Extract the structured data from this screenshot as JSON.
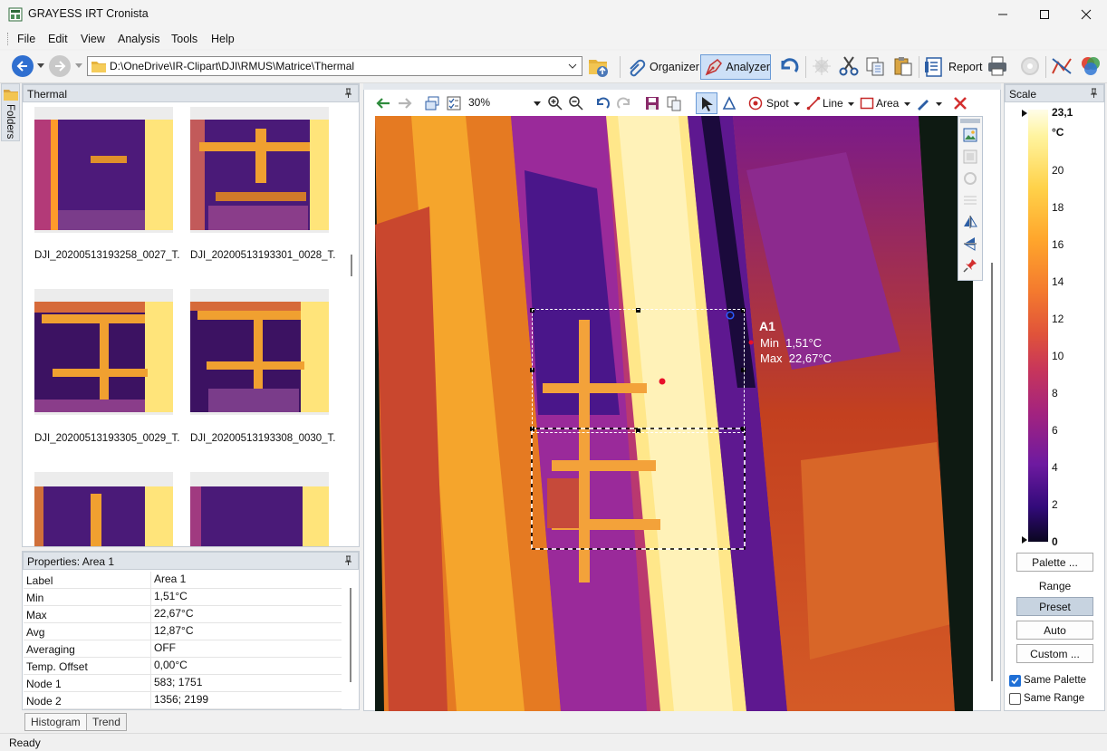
{
  "window": {
    "title": "GRAYESS IRT Cronista"
  },
  "menu": [
    "File",
    "Edit",
    "View",
    "Analysis",
    "Tools",
    "Help"
  ],
  "toolbar": {
    "path": "D:\\OneDrive\\IR-Clipart\\DJI\\RMUS\\Matrice\\Thermal",
    "organizer_label": "Organizer",
    "analyzer_label": "Analyzer",
    "report_label": "Report"
  },
  "thermal_panel": {
    "title": "Thermal",
    "items": [
      {
        "label": "DJI_20200513193258_0027_T..."
      },
      {
        "label": "DJI_20200513193301_0028_T..."
      },
      {
        "label": "DJI_20200513193305_0029_T..."
      },
      {
        "label": "DJI_20200513193308_0030_T..."
      }
    ]
  },
  "folders_tab": {
    "label": "Folders"
  },
  "properties": {
    "title": "Properties: Area 1",
    "rows": [
      {
        "key": "Label",
        "value": "Area 1"
      },
      {
        "key": "Min",
        "value": "1,51°C"
      },
      {
        "key": "Max",
        "value": "22,67°C"
      },
      {
        "key": "Avg",
        "value": "12,87°C"
      },
      {
        "key": "Averaging",
        "value": "OFF"
      },
      {
        "key": "Temp. Offset",
        "value": "0,00°C"
      },
      {
        "key": "Node 1",
        "value": "583; 1751"
      },
      {
        "key": "Node 2",
        "value": "1356; 2199"
      }
    ]
  },
  "bottom_tabs": [
    "Histogram",
    "Trend"
  ],
  "view": {
    "zoom": "30%",
    "spot_label": "Spot",
    "line_label": "Line",
    "area_label": "Area",
    "annotation": {
      "name": "A1",
      "min": "Min  1,51°C",
      "max": "Max  22,67°C"
    }
  },
  "scale": {
    "title": "Scale",
    "max": "23,1",
    "unit": "°C",
    "ticks": [
      "20",
      "18",
      "16",
      "14",
      "12",
      "10",
      "8",
      "6",
      "4",
      "2"
    ],
    "min": "0",
    "palette_btn": "Palette ...",
    "range_label": "Range",
    "preset_btn": "Preset",
    "auto_btn": "Auto",
    "custom_btn": "Custom ...",
    "same_palette": "Same Palette",
    "same_range": "Same Range",
    "same_palette_checked": true,
    "same_range_checked": false
  },
  "status": "Ready"
}
